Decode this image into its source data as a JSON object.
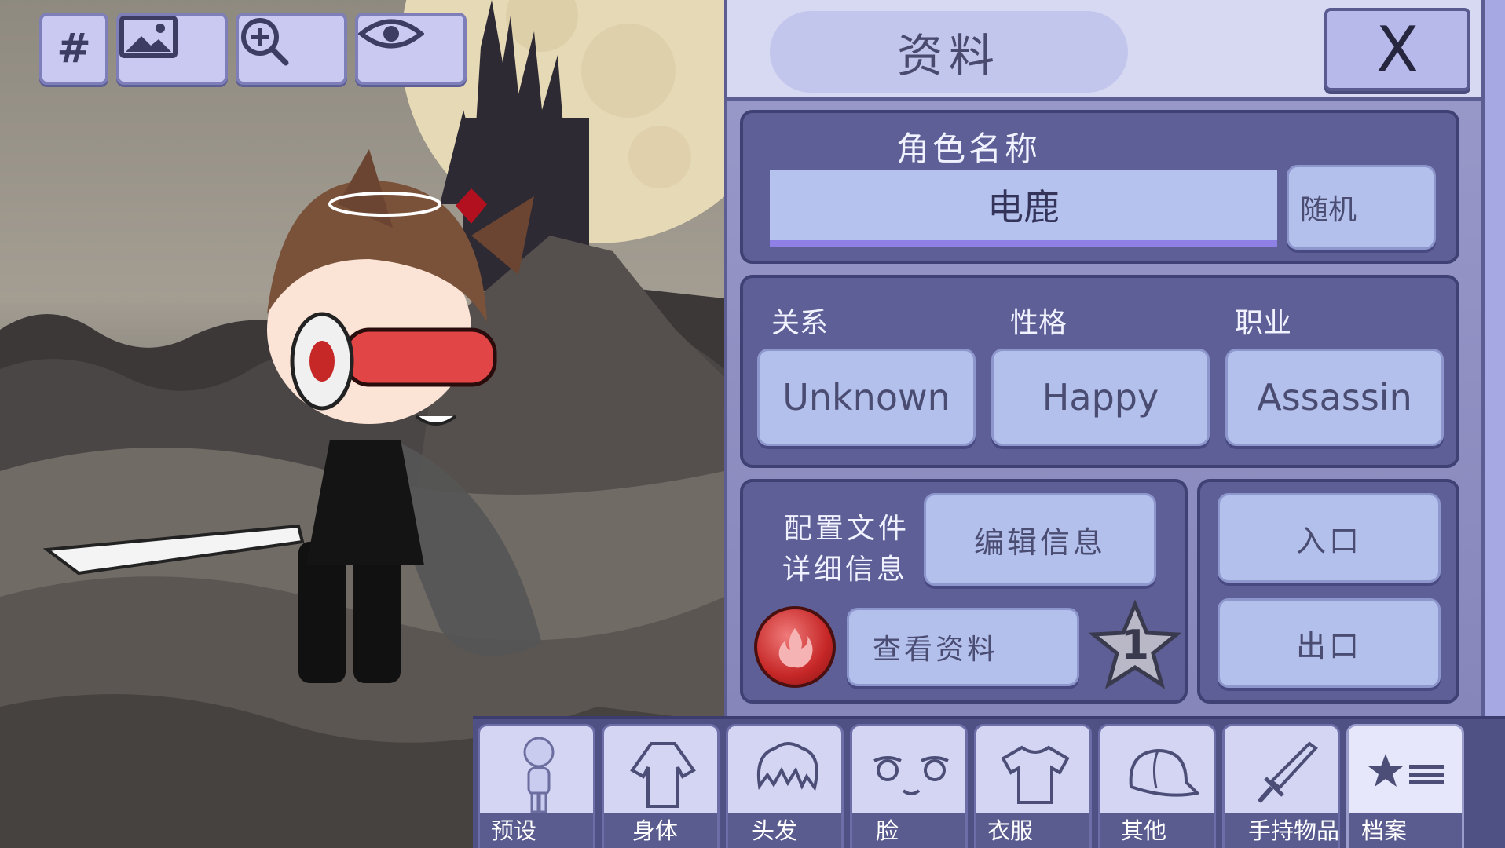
{
  "toolbar": {
    "hashtag_glyph": "#",
    "tools": [
      "grid",
      "background-image",
      "zoom-in",
      "visibility"
    ]
  },
  "panel": {
    "title": "资料",
    "close_label": "X",
    "character_name_heading": "角色名称",
    "character_name_value": "电鹿",
    "random_label": "随机",
    "relationship_label": "关系",
    "personality_label": "性格",
    "occupation_label": "职业",
    "relationship_value": "Unknown",
    "personality_value": "Happy",
    "occupation_value": "Assassin",
    "profile_details_line1": "配置文件",
    "profile_details_line2": "详细信息",
    "edit_info_label": "编辑信息",
    "view_profile_label": "查看资料",
    "star_rank": "1",
    "entrance_label": "入口",
    "exit_label": "出口"
  },
  "tabs": [
    {
      "label": "预设",
      "icon": "preset-figure-icon"
    },
    {
      "label": "身体",
      "icon": "body-icon"
    },
    {
      "label": "头发",
      "icon": "hair-icon"
    },
    {
      "label": "脸",
      "icon": "face-icon"
    },
    {
      "label": "衣服",
      "icon": "shirt-icon"
    },
    {
      "label": "其他",
      "icon": "cap-icon"
    },
    {
      "label": "手持物品",
      "icon": "sword-icon"
    },
    {
      "label": "档案",
      "icon": "profile-list-icon"
    }
  ],
  "active_tab": "档案",
  "colors": {
    "panel_bg": "#8686bb",
    "box_bg": "#5e5f96",
    "button_bg": "#b4c0ec",
    "tab_bg": "#d3d5f2",
    "fire_button": "#d63c3c"
  }
}
